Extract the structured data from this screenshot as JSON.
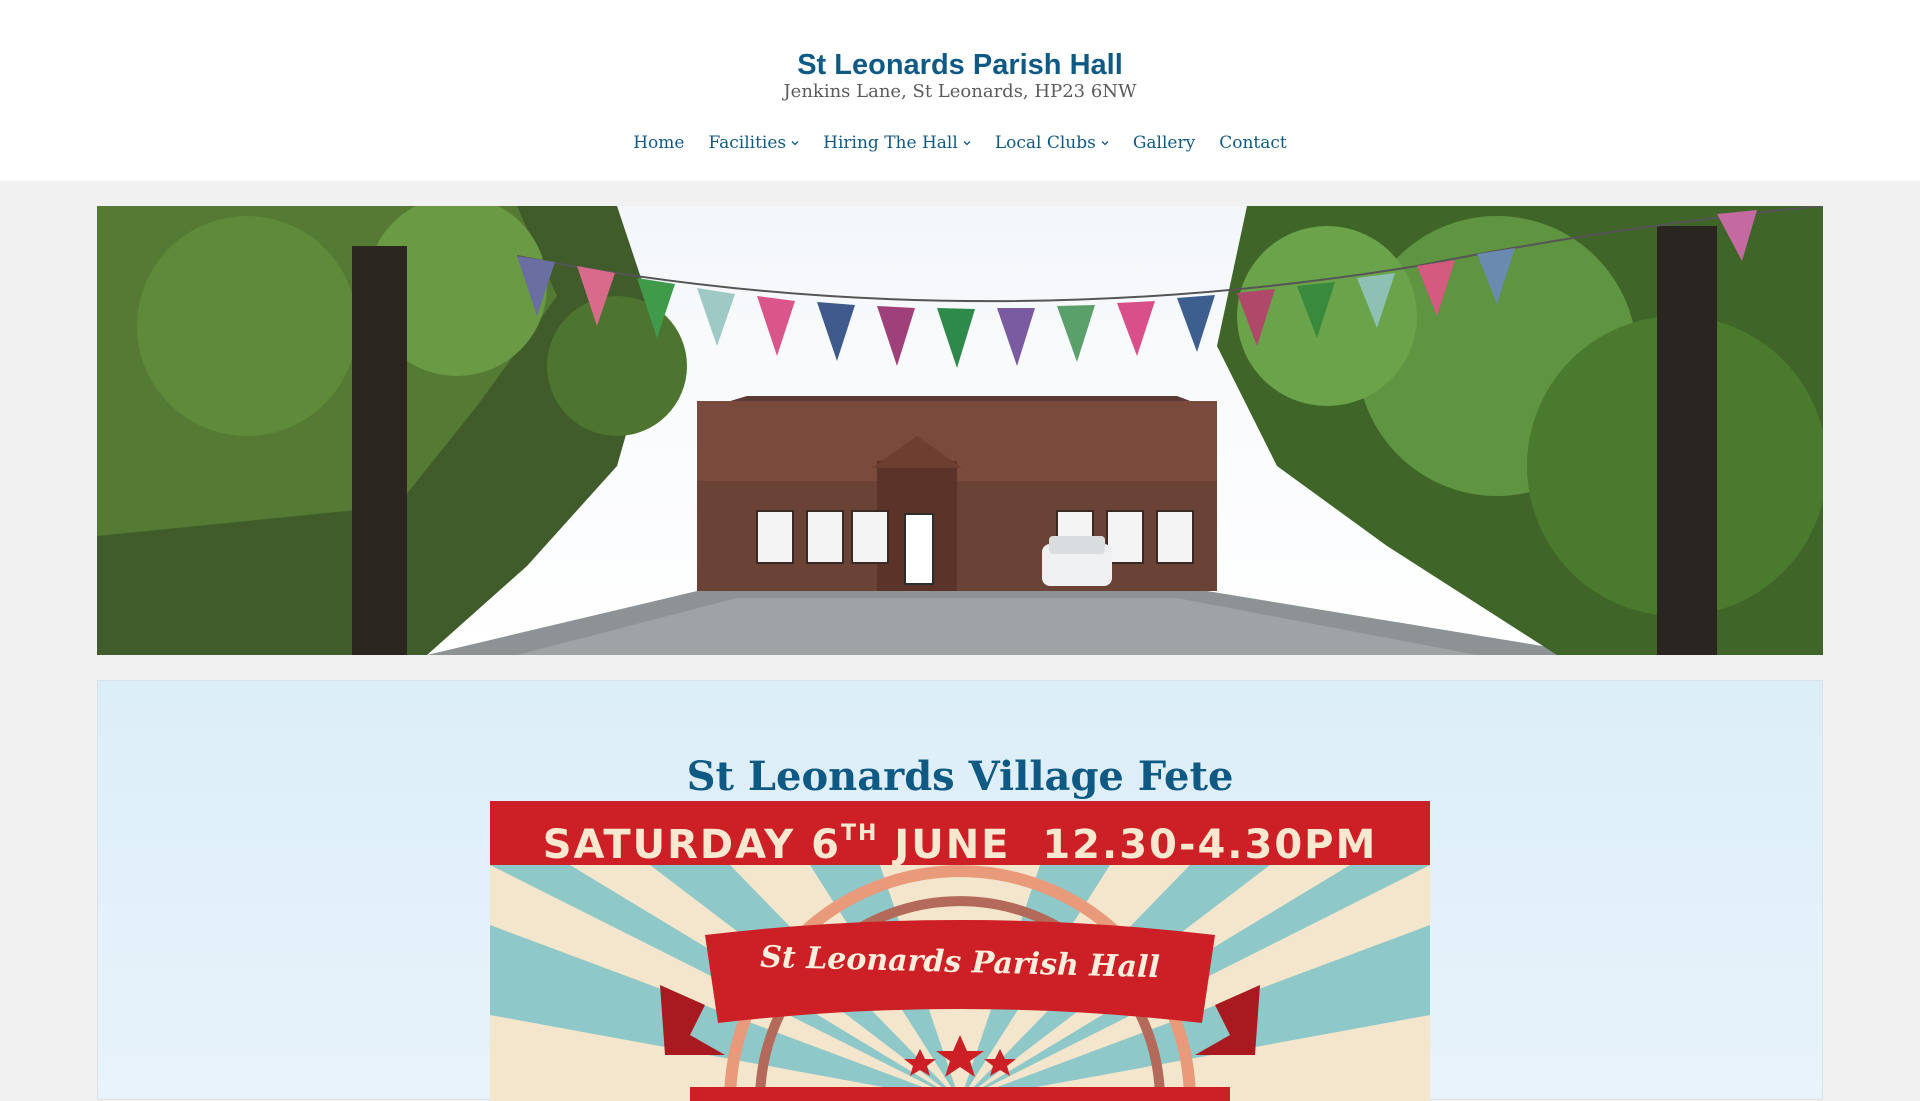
{
  "site": {
    "title": "St Leonards Parish Hall",
    "tagline": "Jenkins Lane, St Leonards, HP23 6NW"
  },
  "nav": [
    {
      "label": "Home",
      "has_dropdown": false
    },
    {
      "label": "Facilities",
      "has_dropdown": true
    },
    {
      "label": "Hiring The Hall",
      "has_dropdown": true
    },
    {
      "label": "Local Clubs",
      "has_dropdown": true
    },
    {
      "label": "Gallery",
      "has_dropdown": false
    },
    {
      "label": "Contact",
      "has_dropdown": false
    }
  ],
  "post": {
    "title": "St Leonards Village Fete",
    "poster": {
      "date_prefix": "SATURDAY 6",
      "date_suffix": "TH",
      "date_rest": " JUNE  12.30-4.30PM",
      "ribbon": "St Leonards Parish Hall"
    }
  },
  "colors": {
    "link": "#0f5a85",
    "poster_red": "#cd1f26",
    "poster_teal": "#8fc8c8",
    "poster_cream": "#f3e6cc"
  },
  "icons": {
    "dropdown": "chevron-down-icon"
  }
}
